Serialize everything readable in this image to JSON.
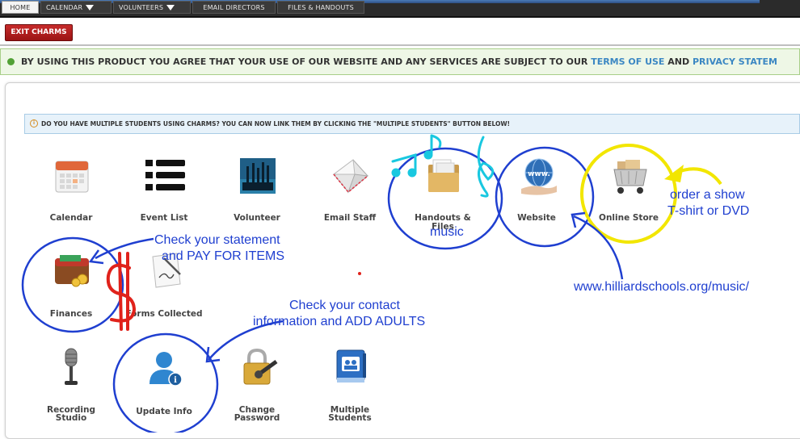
{
  "nav": {
    "tabs": [
      "HOME",
      "CALENDAR",
      "VOLUNTEERS",
      "EMAIL DIRECTORS",
      "FILES & HANDOUTS"
    ],
    "exit_label": "EXIT CHARMS"
  },
  "notice": {
    "text": "BY USING THIS PRODUCT YOU AGREE THAT YOUR USE OF OUR WEBSITE AND ANY SERVICES ARE SUBJECT TO OUR",
    "terms_link": "TERMS OF USE",
    "and": "AND",
    "privacy_link": "PRIVACY STATEM"
  },
  "info_bar": {
    "text": "DO YOU HAVE MULTIPLE STUDENTS USING CHARMS? YOU CAN NOW LINK THEM BY CLICKING THE \"MULTIPLE STUDENTS\" BUTTON BELOW!"
  },
  "tiles": {
    "calendar": "Calendar",
    "event_list": "Event List",
    "volunteer": "Volunteer",
    "email_staff": "Email Staff",
    "handouts": "Handouts & Files",
    "website": "Website",
    "online_store": "Online Store",
    "finances": "Finances",
    "forms": "Forms Collected",
    "recording_1": "Recording",
    "recording_2": "Studio",
    "update_info": "Update Info",
    "change_pw_1": "Change",
    "change_pw_2": "Password",
    "multiple_1": "Multiple",
    "multiple_2": "Students"
  },
  "annotations": {
    "music": "music",
    "store_1": "order a show",
    "store_2": "T-shirt or DVD",
    "statement_1": "Check your statement",
    "statement_2": "and PAY FOR ITEMS",
    "url": "www.hilliardschools.org/music/",
    "contact_1": "Check your contact",
    "contact_2": "information and ADD ADULTS"
  },
  "colors": {
    "ink_blue": "#1f3fd0",
    "highlight_yellow": "#f2e600",
    "dollar_red": "#e0221b",
    "music_cyan": "#19c8e0",
    "exit_red": "#b01e1e"
  }
}
